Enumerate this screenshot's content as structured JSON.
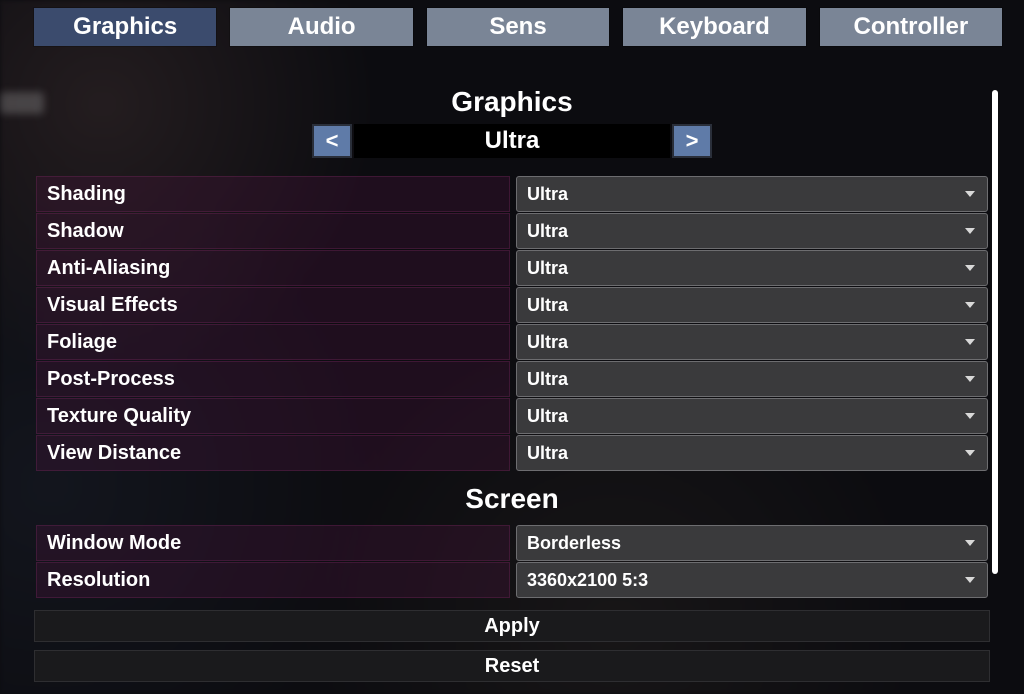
{
  "tabs": [
    {
      "label": "Graphics",
      "active": true
    },
    {
      "label": "Audio",
      "active": false
    },
    {
      "label": "Sens",
      "active": false
    },
    {
      "label": "Keyboard",
      "active": false
    },
    {
      "label": "Controller",
      "active": false
    }
  ],
  "sections": {
    "graphics_title": "Graphics",
    "screen_title": "Screen"
  },
  "preset": {
    "prev_glyph": "<",
    "next_glyph": ">",
    "value": "Ultra"
  },
  "graphics_rows": [
    {
      "label": "Shading",
      "value": "Ultra"
    },
    {
      "label": "Shadow",
      "value": "Ultra"
    },
    {
      "label": "Anti-Aliasing",
      "value": "Ultra"
    },
    {
      "label": "Visual Effects",
      "value": "Ultra"
    },
    {
      "label": "Foliage",
      "value": "Ultra"
    },
    {
      "label": "Post-Process",
      "value": "Ultra"
    },
    {
      "label": "Texture Quality",
      "value": "Ultra"
    },
    {
      "label": "View Distance",
      "value": "Ultra"
    }
  ],
  "screen_rows": [
    {
      "label": "Window Mode",
      "value": "Borderless"
    },
    {
      "label": "Resolution",
      "value": "3360x2100   5:3"
    }
  ],
  "footer": {
    "apply": "Apply",
    "reset": "Reset"
  }
}
